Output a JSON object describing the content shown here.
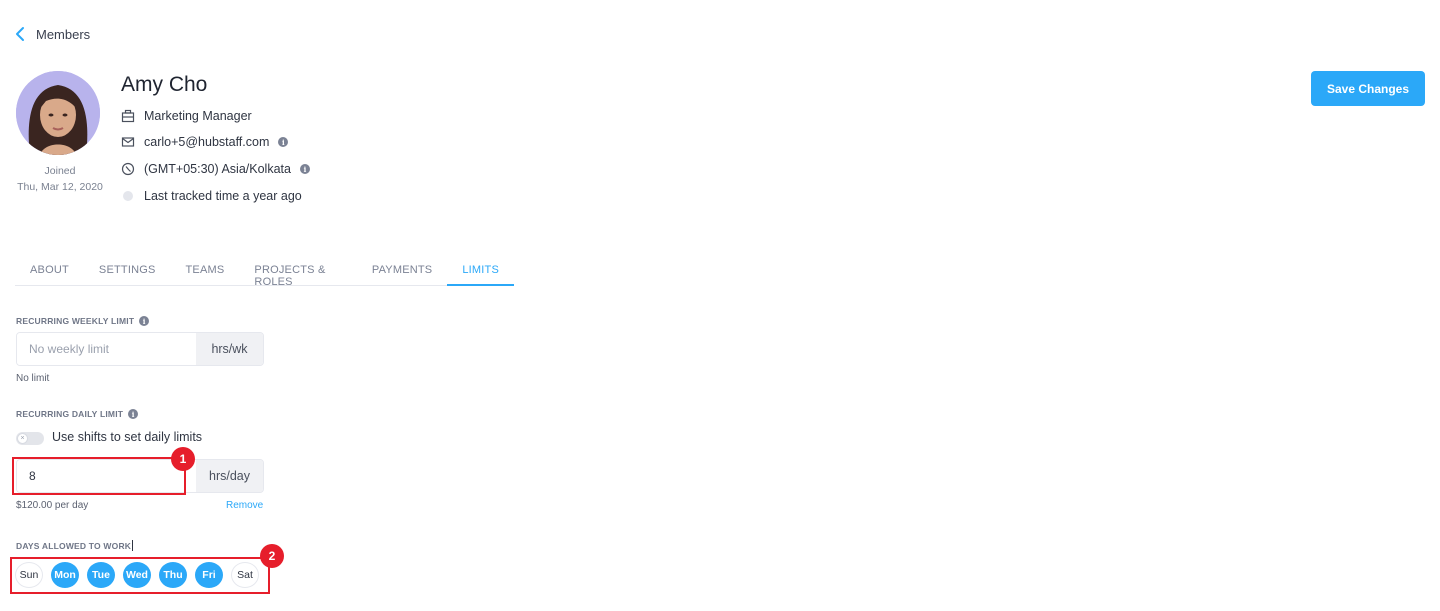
{
  "nav": {
    "back_label": "Members"
  },
  "profile": {
    "name": "Amy Cho",
    "joined_label": "Joined",
    "joined_date": "Thu, Mar 12, 2020",
    "role": "Marketing Manager",
    "email": "carlo+5@hubstaff.com",
    "timezone": "(GMT+05:30) Asia/Kolkata",
    "last_tracked": "Last tracked time a year ago"
  },
  "actions": {
    "save_label": "Save Changes"
  },
  "tabs": [
    {
      "label": "ABOUT",
      "active": false
    },
    {
      "label": "SETTINGS",
      "active": false
    },
    {
      "label": "TEAMS",
      "active": false
    },
    {
      "label": "PROJECTS & ROLES",
      "active": false
    },
    {
      "label": "PAYMENTS",
      "active": false
    },
    {
      "label": "LIMITS",
      "active": true
    }
  ],
  "limits": {
    "weekly": {
      "label": "RECURRING WEEKLY LIMIT",
      "value": "",
      "placeholder": "No weekly limit",
      "unit": "hrs/wk",
      "helper": "No limit"
    },
    "daily": {
      "label": "RECURRING DAILY LIMIT",
      "toggle_label": "Use shifts to set daily limits",
      "toggle_on": false,
      "value": "8",
      "unit": "hrs/day",
      "helper": "$120.00 per day",
      "remove_label": "Remove"
    },
    "days": {
      "label": "DAYS ALLOWED TO WORK",
      "items": [
        {
          "label": "Sun",
          "selected": false
        },
        {
          "label": "Mon",
          "selected": true
        },
        {
          "label": "Tue",
          "selected": true
        },
        {
          "label": "Wed",
          "selected": true
        },
        {
          "label": "Thu",
          "selected": true
        },
        {
          "label": "Fri",
          "selected": true
        },
        {
          "label": "Sat",
          "selected": false
        }
      ]
    }
  },
  "annotations": [
    {
      "number": "1"
    },
    {
      "number": "2"
    }
  ],
  "colors": {
    "accent": "#2ba8f8",
    "annotation": "#e61e2b"
  }
}
